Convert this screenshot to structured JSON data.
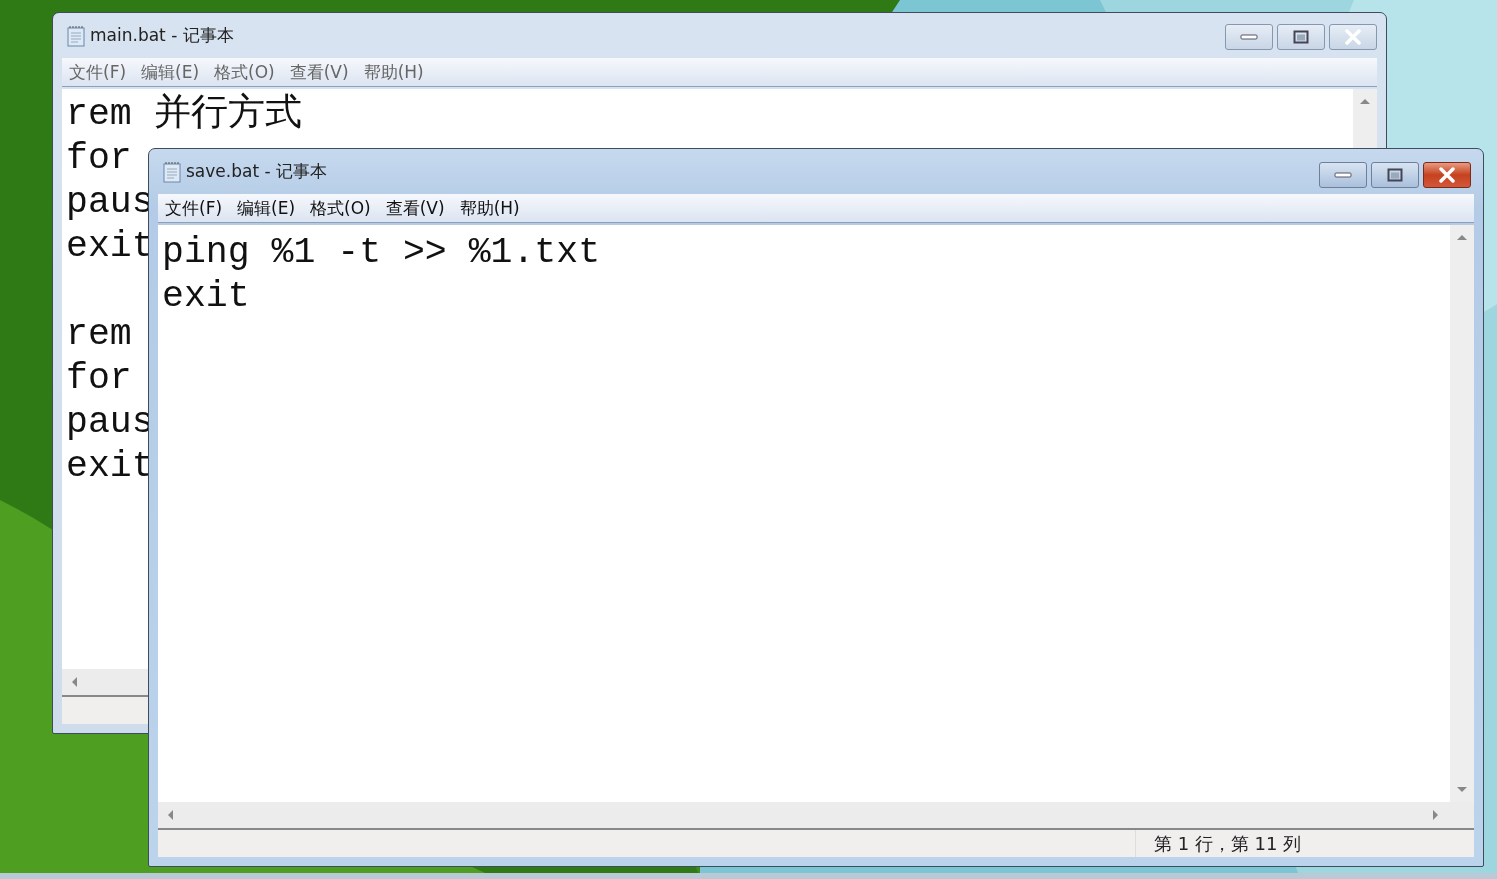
{
  "windows": [
    {
      "title": "main.bat - 记事本",
      "active": false,
      "menu": [
        "文件(F)",
        "编辑(E)",
        "格式(O)",
        "查看(V)",
        "帮助(H)"
      ],
      "blocks": [
        [
          "rem 并行方式",
          "for",
          "paus",
          "exit"
        ],
        [
          "rem",
          "for",
          "paus",
          "exit"
        ]
      ]
    },
    {
      "title": "save.bat - 记事本",
      "active": true,
      "menu": [
        "文件(F)",
        "编辑(E)",
        "格式(O)",
        "查看(V)",
        "帮助(H)"
      ],
      "blocks": [
        [
          "ping %1 -t >> %1.txt",
          "exit"
        ]
      ],
      "status": "第 1 行，第 11 列"
    }
  ]
}
